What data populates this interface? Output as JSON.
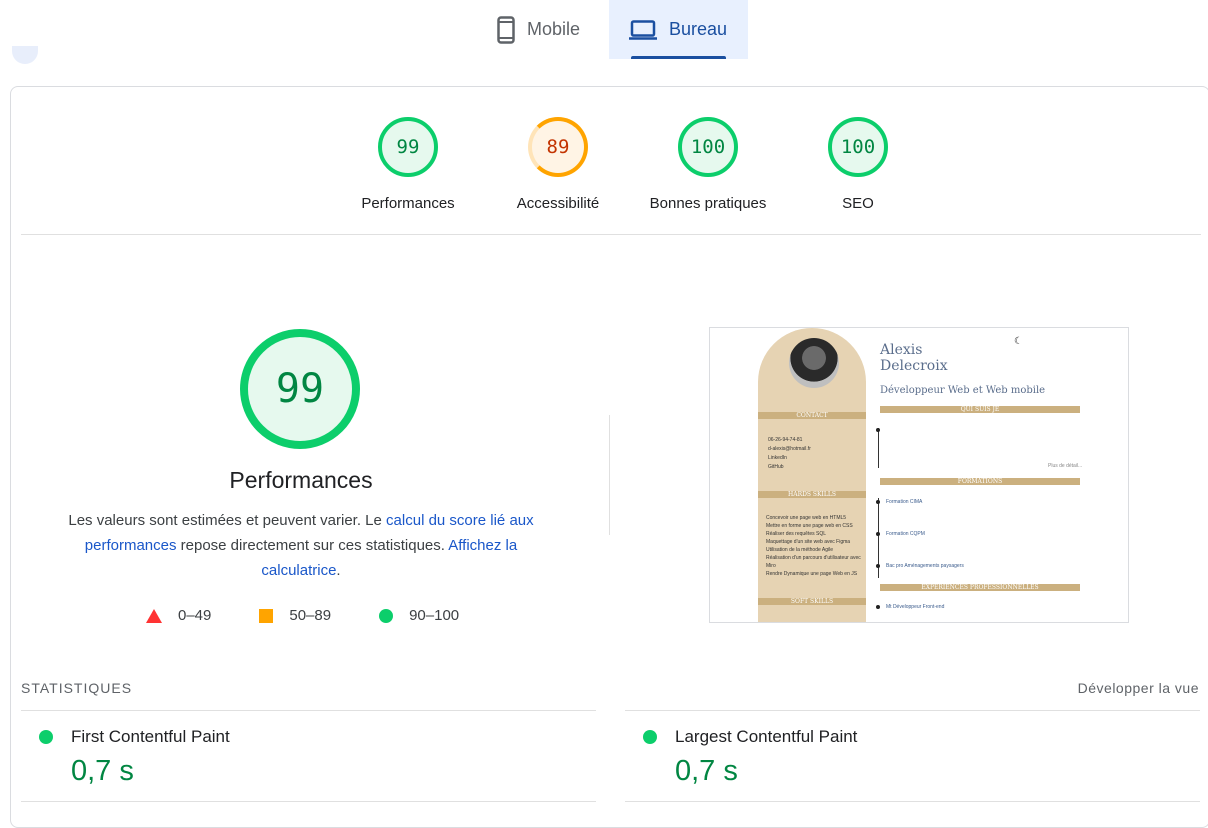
{
  "tabs": {
    "mobile": "Mobile",
    "desktop": "Bureau"
  },
  "categories": [
    {
      "label": "Performances",
      "score": "99",
      "rating": "pass"
    },
    {
      "label": "Accessibilité",
      "score": "89",
      "rating": "average"
    },
    {
      "label": "Bonnes pratiques",
      "score": "100",
      "rating": "pass"
    },
    {
      "label": "SEO",
      "score": "100",
      "rating": "pass"
    }
  ],
  "main": {
    "score": "99",
    "title": "Performances",
    "desc_before": "Les valeurs sont estimées et peuvent varier. Le ",
    "desc_link1": "calcul du score lié aux performances",
    "desc_middle": " repose directement sur ces statistiques. ",
    "desc_link2": "Affichez la calculatrice",
    "desc_after": "."
  },
  "legend": {
    "fail": "0–49",
    "average": "50–89",
    "pass": "90–100"
  },
  "colors": {
    "pass": "#0cce6b",
    "average": "#ffa400",
    "fail": "#ff3333",
    "accent": "#1a4fa0"
  },
  "preview": {
    "name_first": "Alexis",
    "name_last": "Delecroix",
    "role": "Développeur Web et Web mobile",
    "sections": [
      "QUI SUIS JE",
      "FORMATIONS",
      "EXPERIENCES PROFESSIONNELLES"
    ],
    "side_sections": [
      "CONTACT",
      "HARDS SKILLS",
      "SOFT SKILLS"
    ],
    "contact": [
      "06-26-94-74-81",
      "d-alexis@hotmail.fr",
      "LinkedIn",
      "GitHub"
    ],
    "skills": [
      "Concevoir une page web en HTML5",
      "Mettre en forme une page web en CSS",
      "Réaliser des requêtes SQL",
      "Maquettage d'un site web avec Figma",
      "Utilisation de la méthode Agile",
      "Réalisation d'un parcours d'utilisateur avec Miro",
      "Rendre Dynamique une page Web en JS"
    ],
    "formations": [
      "Formation CIMA",
      "Formation CQPM",
      "Bac pro Aménagements paysagers"
    ],
    "more": "Plus de détail...",
    "job": "Mt Développeur Front-end"
  },
  "stats": {
    "title": "STATISTIQUES",
    "expand": "Développer la vue",
    "metrics": [
      {
        "name": "First Contentful Paint",
        "value": "0,7 s"
      },
      {
        "name": "Largest Contentful Paint",
        "value": "0,7 s"
      }
    ]
  }
}
